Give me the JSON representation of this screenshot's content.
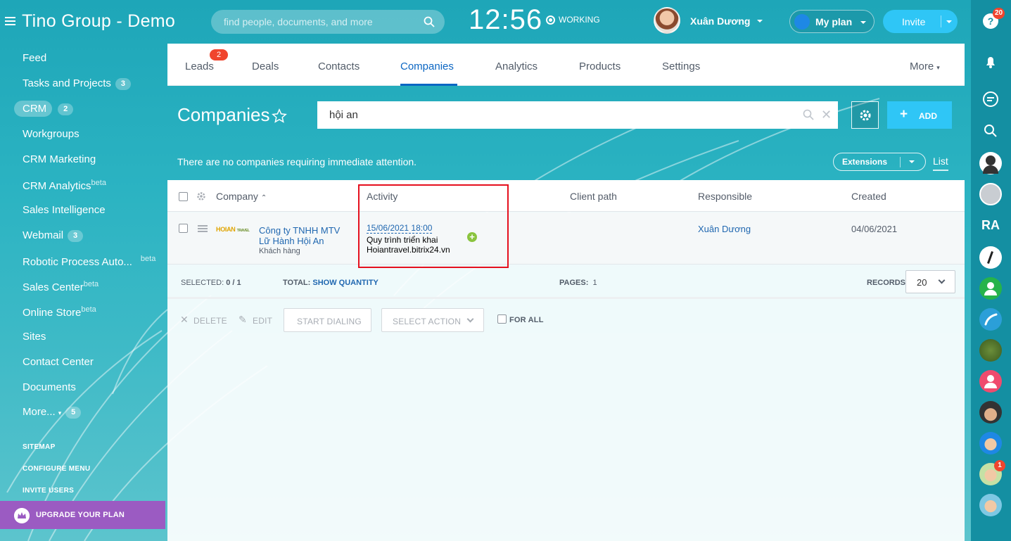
{
  "header": {
    "app_title": "Tino Group - Demo",
    "search_placeholder": "find people, documents, and more",
    "clock": "12:56",
    "work_status": "WORKING",
    "user_name": "Xuân Dương",
    "myplan_label": "My plan",
    "invite_label": "Invite"
  },
  "sidebar": {
    "items": [
      {
        "label": "Feed"
      },
      {
        "label": "Tasks and Projects",
        "count": "3"
      },
      {
        "label": "CRM",
        "count": "2"
      },
      {
        "label": "Workgroups"
      },
      {
        "label": "CRM Marketing"
      },
      {
        "label": "CRM Analytics",
        "sup": "beta"
      },
      {
        "label": "Sales Intelligence"
      },
      {
        "label": "Webmail",
        "count": "3"
      },
      {
        "label": "Robotic Process Auto...",
        "sup": "beta"
      },
      {
        "label": "Sales Center",
        "sup": "beta"
      },
      {
        "label": "Online Store",
        "sup": "beta"
      },
      {
        "label": "Sites"
      },
      {
        "label": "Contact Center"
      },
      {
        "label": "Documents"
      },
      {
        "label": "More...",
        "count": "5"
      }
    ],
    "sitemap": "SITEMAP",
    "configure_menu": "CONFIGURE MENU",
    "invite_users": "INVITE USERS",
    "upgrade": "UPGRADE YOUR PLAN"
  },
  "tabs": [
    {
      "label": "Leads",
      "badge": "2"
    },
    {
      "label": "Deals"
    },
    {
      "label": "Contacts"
    },
    {
      "label": "Companies"
    },
    {
      "label": "Analytics"
    },
    {
      "label": "Products"
    },
    {
      "label": "Settings"
    },
    {
      "label": "More"
    }
  ],
  "page": {
    "title": "Companies",
    "filter_value": "hội an",
    "add_label": "ADD",
    "notice": "There are no companies requiring immediate attention.",
    "extensions_label": "Extensions",
    "list_label": "List"
  },
  "grid": {
    "columns": [
      "Company",
      "Activity",
      "Client path",
      "Responsible",
      "Created"
    ],
    "rows": [
      {
        "logo_text": "HOIAN",
        "logo_sub": "TRAVEL",
        "company": "Công ty TNHH MTV Lữ Hành Hội An",
        "company_type": "Khách hàng",
        "activity_date": "15/06/2021 18:00",
        "activity_line1": "Quy trình triển khai",
        "activity_line2": "Hoiantravel.bitrix24.vn",
        "client_path": "",
        "responsible": "Xuân Dương",
        "created": "04/06/2021"
      }
    ],
    "footer": {
      "selected_label": "SELECTED:",
      "selected_value": "0 / 1",
      "total_label": "TOTAL:",
      "total_link": "SHOW QUANTITY",
      "pages_label": "PAGES:",
      "pages_value": "1",
      "records_label": "RECORDS:",
      "records_value": "20"
    },
    "actions": {
      "delete": "DELETE",
      "edit": "EDIT",
      "start_dialing": "START DIALING",
      "select_action": "SELECT ACTION",
      "for_all": "FOR ALL"
    }
  },
  "rightbar": {
    "help_badge": "20",
    "chat_badge": "1"
  },
  "colors": {
    "accent": "#2fc6f6",
    "link": "#2067b0",
    "active_tab": "#0b66c3",
    "badge": "#f0452e",
    "upgrade": "#9b5bc2",
    "highlight": "#e5101e"
  }
}
